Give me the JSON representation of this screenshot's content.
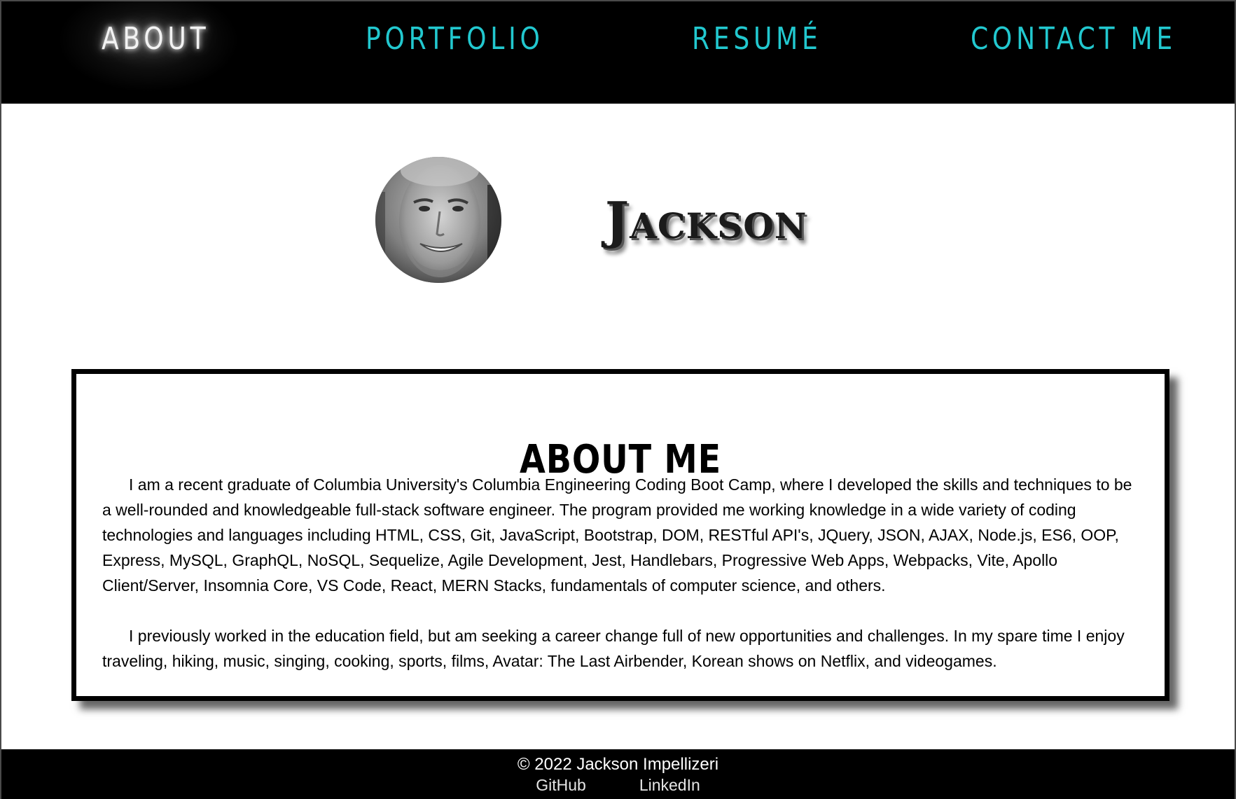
{
  "nav": {
    "items": [
      {
        "label": "ABOUT",
        "active": true
      },
      {
        "label": "PORTFOLIO",
        "active": false
      },
      {
        "label": "RESUMÉ",
        "active": false
      },
      {
        "label": "CONTACT ME",
        "active": false
      }
    ]
  },
  "hero": {
    "name": "Jackson"
  },
  "about": {
    "title": "ABOUT ME",
    "paragraphs": [
      "I am a recent graduate of Columbia University's Columbia Engineering Coding Boot Camp, where I developed the skills and techniques to be a well-rounded and knowledgeable full-stack software engineer. The program provided me working knowledge in a wide variety of coding technologies and languages including HTML, CSS, Git, JavaScript, Bootstrap, DOM, RESTful API's, JQuery, JSON, AJAX, Node.js, ES6, OOP, Express, MySQL, GraphQL, NoSQL, Sequelize, Agile Development, Jest, Handlebars, Progressive Web Apps, Webpacks, Vite, Apollo Client/Server, Insomnia Core, VS Code, React, MERN Stacks, fundamentals of computer science, and others.",
      "I previously worked in the education field, but am seeking a career change full of new opportunities and challenges. In my spare time I enjoy traveling, hiking, music, singing, cooking, sports, films, Avatar: The Last Airbender, Korean shows on Netflix, and videogames."
    ]
  },
  "footer": {
    "copyright": "© 2022 Jackson Impellizeri",
    "links": [
      {
        "label": "GitHub"
      },
      {
        "label": "LinkedIn"
      }
    ]
  },
  "colors": {
    "nav_bg": "#000000",
    "nav_link": "#22c8cf",
    "nav_active": "#f2f2f2",
    "footer_bg": "#000000"
  },
  "icons": {
    "avatar": "profile-photo"
  }
}
